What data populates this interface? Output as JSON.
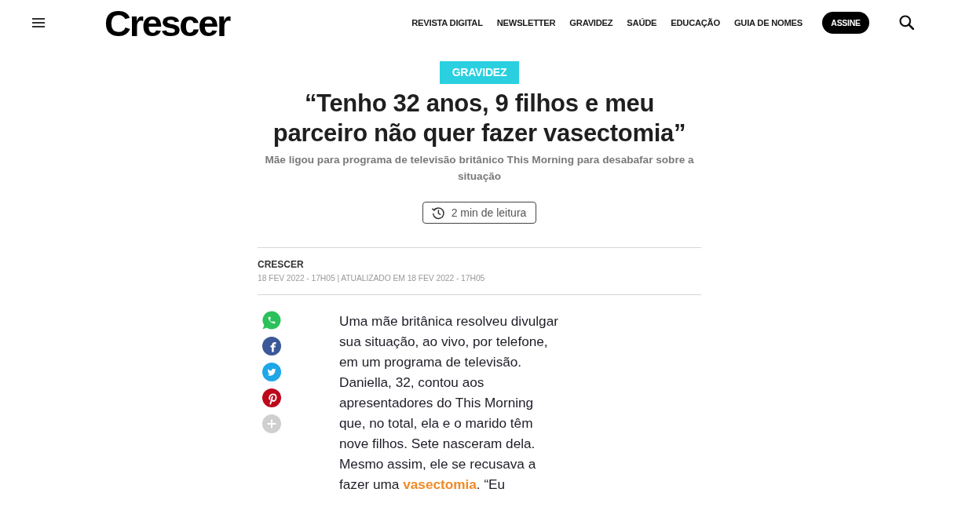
{
  "header": {
    "brand": "Crescer",
    "nav": [
      {
        "label": "REVISTA DIGITAL"
      },
      {
        "label": "NEWSLETTER"
      },
      {
        "label": "GRAVIDEZ"
      },
      {
        "label": "SAÚDE"
      },
      {
        "label": "EDUCAÇÃO"
      },
      {
        "label": "GUIA DE NOMES"
      }
    ],
    "subscribe": "ASSINE"
  },
  "article": {
    "category": "GRAVIDEZ",
    "headline": "“Tenho 32 anos, 9 filhos e meu parceiro não quer fazer vasectomia”",
    "subtitle": "Mãe ligou para programa de televisão britânico This Morning para desabafar sobre a situação",
    "reading_time": "2 min de leitura",
    "source": "CRESCER",
    "dateline": "18 FEV 2022 - 17H05 | ATUALIZADO EM 18 FEV 2022 - 17H05",
    "body": [
      {
        "kind": "text",
        "text": "Uma mãe britânica resolveu divulgar sua situação, ao vivo, por telefone, em um programa de televisão. Daniella, 32, contou aos apresentadores do This Morning que, no total, ela e o marido têm nove filhos. Sete nasceram dela. Mesmo assim, ele se recusava a fazer uma "
      },
      {
        "kind": "link",
        "text": "vasectomia"
      },
      {
        "kind": "text",
        "text": ". “Eu"
      }
    ]
  }
}
